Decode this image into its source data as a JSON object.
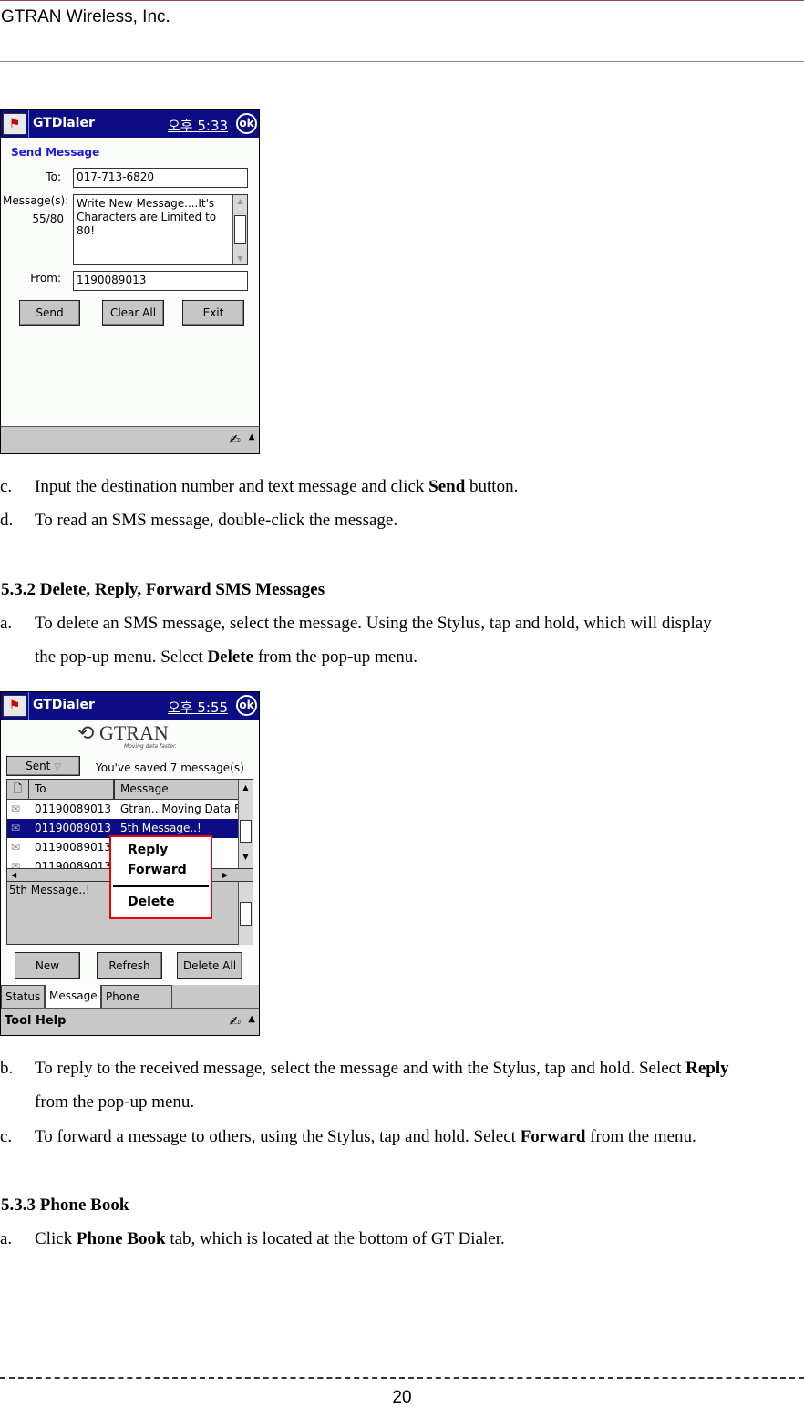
{
  "header": {
    "company": "GTRAN Wireless, Inc."
  },
  "screen1": {
    "app_title": "GTDialer",
    "time": "오후 5:33",
    "ok_label": "ok",
    "heading": "Send Message",
    "to_label": "To:",
    "to_value": "017-713-6820",
    "message_label": "Message(s):",
    "message_count": "55/80",
    "message_value": "Write New Message....It's\nCharacters are Limited to 80!",
    "from_label": "From:",
    "from_value": "1190089013",
    "buttons": [
      "Send",
      "Clear All",
      "Exit"
    ]
  },
  "text1": [
    {
      "marker": "c.",
      "text": "Input the destination number and text message and click ",
      "bold": "Send",
      "after": " button."
    },
    {
      "marker": "d.",
      "text": "To read an SMS message, double-click the message.",
      "bold": "",
      "after": ""
    }
  ],
  "section532": {
    "heading": "5.3.2 Delete, Reply, Forward SMS Messages",
    "a_marker": "a.",
    "a_line1": "To delete an SMS message, select the message.     Using the Stylus, tap and hold, which will display",
    "a_line2_pre": "the pop-up menu. Select ",
    "a_line2_bold": "Delete",
    "a_line2_post": " from the pop-up menu."
  },
  "screen2": {
    "app_title": "GTDialer",
    "time": "오후 5:55",
    "ok_label": "ok",
    "logo_text": "GTRAN",
    "logo_tagline": "Moving data faster.",
    "folder": "Sent",
    "saved_text": "You've saved 7 message(s)",
    "columns": [
      "To",
      "Message"
    ],
    "rows": [
      {
        "to": "01190089013",
        "message": "Gtran...Moving Data F",
        "selected": false
      },
      {
        "to": "01190089013",
        "message": "5th Message..!",
        "selected": true
      },
      {
        "to": "01190089013",
        "message": "",
        "selected": false
      },
      {
        "to": "01190089013",
        "message": "",
        "selected": false
      }
    ],
    "preview": "5th Message..!",
    "popup": [
      "Reply",
      "Forward",
      "Delete"
    ],
    "buttons": [
      "New",
      "Refresh",
      "Delete All"
    ],
    "tabs": [
      "Status",
      "Message",
      "Phone Book"
    ],
    "active_tab": "Message",
    "menu": "Tool Help",
    "selection_color": "#0c0c84"
  },
  "text2": [
    {
      "marker": "b.",
      "line1_pre": "To reply to the received message, select the message and with the Stylus, tap and hold. Select ",
      "line1_bold": "Reply",
      "line2": "from the pop-up menu."
    },
    {
      "marker": "c.",
      "pre": "To forward a message to others, using the Stylus, tap and hold. Select ",
      "bold": "Forward",
      "post": " from the menu."
    }
  ],
  "section533": {
    "heading": "5.3.3 Phone Book",
    "a_marker": "a.",
    "pre": "Click ",
    "bold": "Phone Book",
    "post": " tab, which is located at the bottom of GT Dialer."
  },
  "footer": {
    "page_number": "20"
  }
}
